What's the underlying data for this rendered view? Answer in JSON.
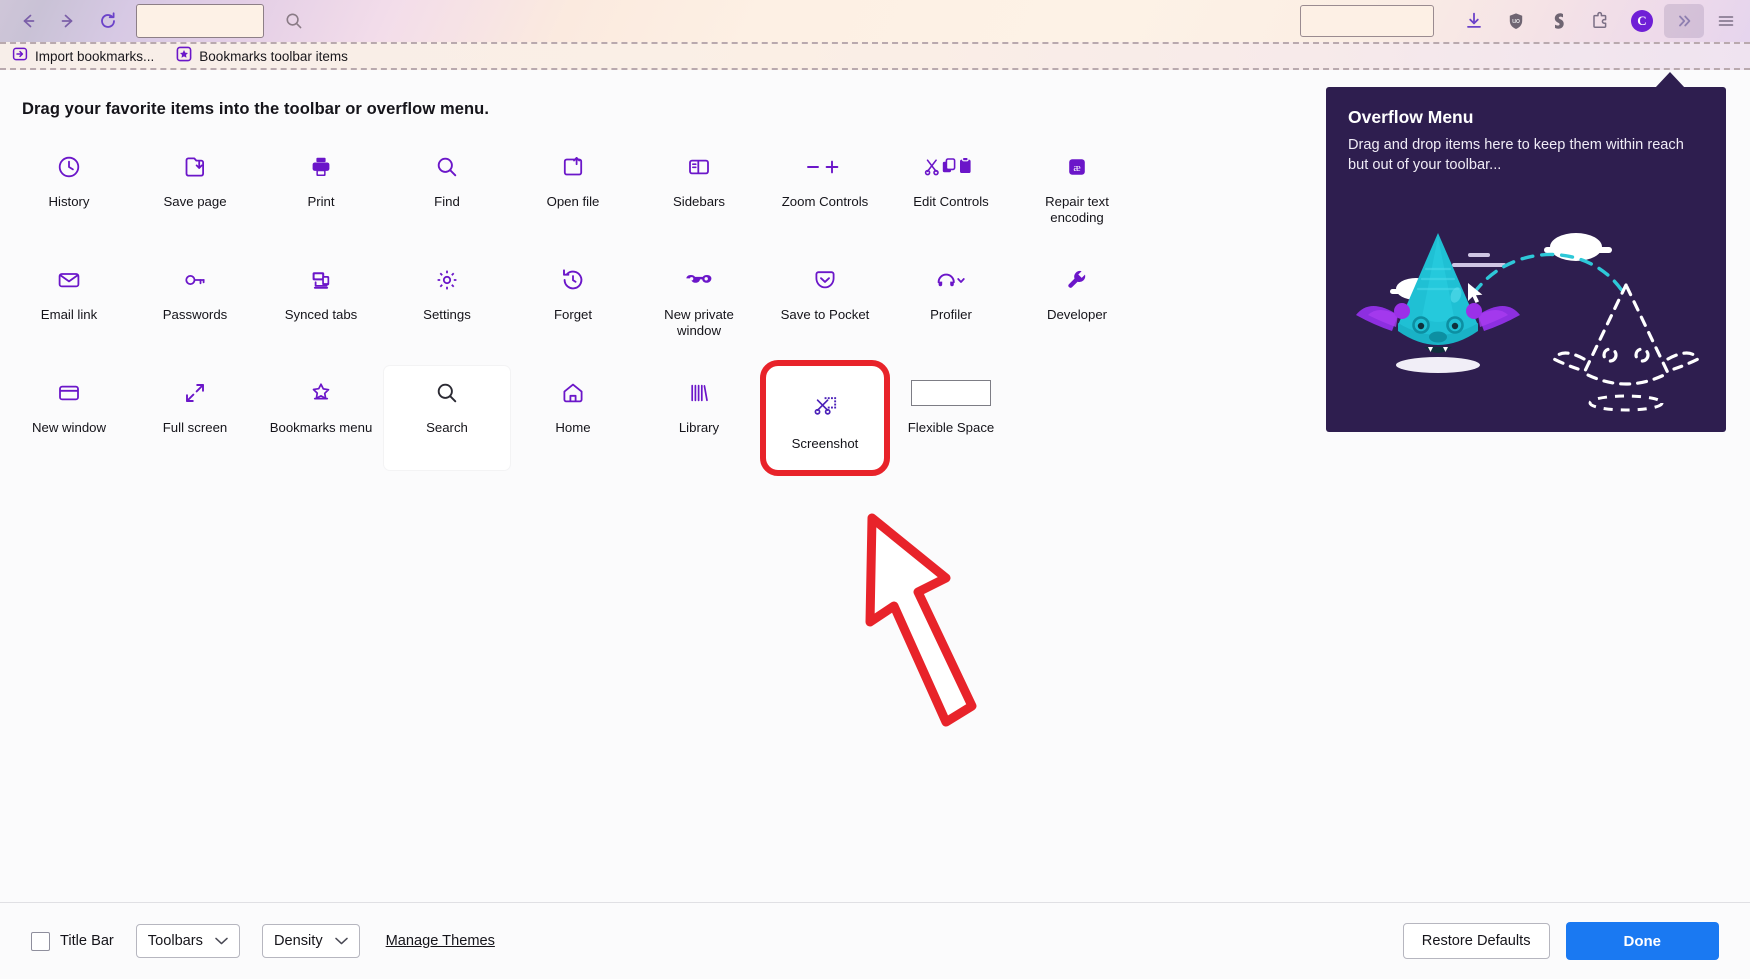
{
  "nav_toolbar": {
    "back_icon": "back-arrow-icon",
    "forward_icon": "forward-arrow-icon",
    "reload_icon": "reload-icon",
    "address_bar_value": "",
    "address_bar_placeholder": "",
    "search_icon": "search-icon",
    "secondary_bar_value": "",
    "right_icons": [
      {
        "name": "downloads-icon",
        "label": "Downloads"
      },
      {
        "name": "ublock-origin-icon",
        "label": "uBlock Origin"
      },
      {
        "name": "surfshark-icon",
        "label": "Surfshark"
      },
      {
        "name": "extensions-icon",
        "label": "Extensions"
      },
      {
        "name": "account-avatar",
        "label": "C"
      },
      {
        "name": "overflow-menu-icon",
        "label": "»"
      },
      {
        "name": "app-menu-icon",
        "label": "Open application menu"
      }
    ]
  },
  "bookmarks_toolbar": {
    "items": [
      {
        "label": "Import bookmarks...",
        "icon": "import-bookmarks-icon"
      },
      {
        "label": "Bookmarks toolbar items",
        "icon": "bookmarks-star-icon"
      }
    ]
  },
  "customize": {
    "headline": "Drag your favorite items into the toolbar or overflow menu.",
    "palette_rows": [
      [
        {
          "label": "History",
          "icon": "clock-icon",
          "state": "normal"
        },
        {
          "label": "Save page",
          "icon": "save-page-icon",
          "state": "normal"
        },
        {
          "label": "Print",
          "icon": "printer-icon",
          "state": "normal"
        },
        {
          "label": "Find",
          "icon": "magnifier-icon",
          "state": "normal"
        },
        {
          "label": "Open file",
          "icon": "open-file-icon",
          "state": "normal"
        },
        {
          "label": "Sidebars",
          "icon": "sidebar-icon",
          "state": "normal"
        },
        {
          "label": "Zoom Controls",
          "icon": "zoom-minus-plus-icon",
          "state": "normal"
        },
        {
          "label": "Edit Controls",
          "icon": "cut-copy-paste-icon",
          "state": "normal"
        },
        {
          "label": "Repair text encoding",
          "icon": "text-encoding-icon",
          "state": "normal"
        }
      ],
      [
        {
          "label": "Email link",
          "icon": "envelope-icon",
          "state": "normal"
        },
        {
          "label": "Passwords",
          "icon": "key-icon",
          "state": "normal"
        },
        {
          "label": "Synced tabs",
          "icon": "synced-tabs-icon",
          "state": "normal"
        },
        {
          "label": "Settings",
          "icon": "gear-icon",
          "state": "normal"
        },
        {
          "label": "Forget",
          "icon": "forget-clock-icon",
          "state": "normal"
        },
        {
          "label": "New private window",
          "icon": "private-mask-icon",
          "state": "normal"
        },
        {
          "label": "Save to Pocket",
          "icon": "pocket-icon",
          "state": "normal"
        },
        {
          "label": "Profiler",
          "icon": "profiler-icon",
          "state": "normal"
        },
        {
          "label": "Developer",
          "icon": "wrench-icon",
          "state": "normal"
        }
      ],
      [
        {
          "label": "New window",
          "icon": "new-window-icon",
          "state": "normal"
        },
        {
          "label": "Full screen",
          "icon": "fullscreen-arrows-icon",
          "state": "normal"
        },
        {
          "label": "Bookmarks menu",
          "icon": "bookmarks-menu-icon",
          "state": "normal"
        },
        {
          "label": "Search",
          "icon": "search-magnifier-icon",
          "state": "hovered"
        },
        {
          "label": "Home",
          "icon": "home-icon",
          "state": "normal"
        },
        {
          "label": "Library",
          "icon": "library-icon",
          "state": "normal"
        },
        {
          "label": "Screenshot",
          "icon": "screenshot-scissors-icon",
          "state": "highlighted"
        },
        {
          "label": "Flexible Space",
          "icon": "flexible-space-rect",
          "state": "normal"
        }
      ]
    ],
    "annotation": {
      "type": "red-arrow",
      "points_to": "Screenshot",
      "color": "#e8232a"
    }
  },
  "overflow_panel": {
    "title": "Overflow Menu",
    "description": "Drag and drop items here to keep them within reach but out of your toolbar...",
    "background_color": "#2e1e4f",
    "illustration": "fox-creature-with-dashed-outline"
  },
  "bottom_bar": {
    "title_bar_checkbox": {
      "label": "Title Bar",
      "checked": false
    },
    "toolbars_dropdown": "Toolbars",
    "density_dropdown": "Density",
    "manage_themes_link": "Manage Themes",
    "restore_defaults_button": "Restore Defaults",
    "done_button": "Done",
    "done_button_color": "#1a79f2"
  }
}
